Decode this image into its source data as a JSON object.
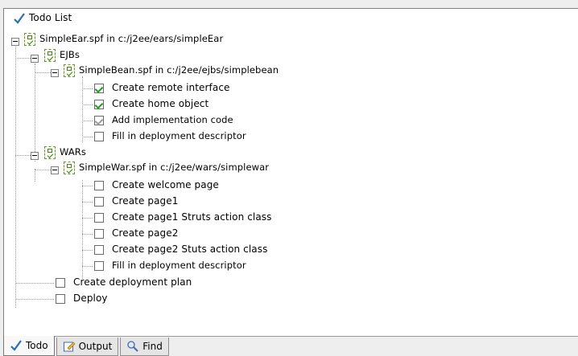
{
  "tree": {
    "root": {
      "label": "Todo List",
      "icon": "check-icon"
    },
    "items": [
      {
        "label": "SimpleEar.spf in c:/j2ee/ears/simpleEar",
        "icon": "todo-file-icon"
      },
      {
        "label": "EJBs",
        "icon": "todo-folder-icon"
      },
      {
        "label": "SimpleBean.spf in c:/j2ee/ejbs/simplebean",
        "icon": "todo-file-icon"
      },
      {
        "label": "Create remote interface",
        "checked": true
      },
      {
        "label": "Create home object",
        "checked": true
      },
      {
        "label": "Add implementation code",
        "checked": true
      },
      {
        "label": "Fill in deployment descriptor",
        "checked": false
      },
      {
        "label": "WARs",
        "icon": "todo-folder-icon"
      },
      {
        "label": "SimpleWar.spf in c:/j2ee/wars/simplewar",
        "icon": "todo-file-icon"
      },
      {
        "label": "Create welcome page",
        "checked": false
      },
      {
        "label": "Create page1",
        "checked": false
      },
      {
        "label": "Create page1 Struts action class",
        "checked": false
      },
      {
        "label": "Create page2",
        "checked": false
      },
      {
        "label": "Create page2 Stuts action class",
        "checked": false
      },
      {
        "label": "Fill in deployment descriptor",
        "checked": false
      },
      {
        "label": "Create deployment plan",
        "checked": false
      },
      {
        "label": "Deploy",
        "checked": false
      }
    ]
  },
  "tabs": [
    {
      "label": "Todo",
      "icon": "check-icon",
      "active": true
    },
    {
      "label": "Output",
      "icon": "pencil-icon",
      "active": false
    },
    {
      "label": "Find",
      "icon": "magnifier-icon",
      "active": false
    }
  ],
  "colors": {
    "check_green": "#1f9b1f",
    "panel_bg": "#ffffff",
    "window_bg": "#eeeeee"
  }
}
